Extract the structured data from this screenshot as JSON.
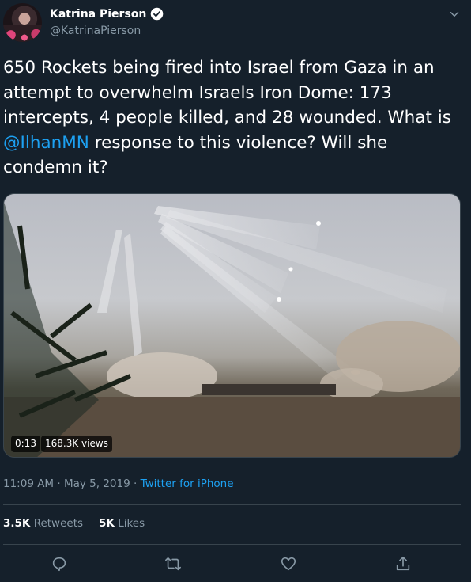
{
  "user": {
    "display_name": "Katrina Pierson",
    "handle": "@KatrinaPierson",
    "verified_icon": "verified-badge-icon"
  },
  "tweet": {
    "text_before": "650 Rockets being fired into Israel from Gaza in an attempt to overwhelm Israels Iron Dome: 173 intercepts, 4 people killed, and 28 wounded. What is ",
    "mention": "@IlhanMN",
    "text_after": " response to this violence? Will she condemn it?"
  },
  "media": {
    "duration": "0:13",
    "views": "168.3K views"
  },
  "meta": {
    "time": "11:09 AM · May 5, 2019 · ",
    "source": "Twitter for iPhone"
  },
  "stats": {
    "retweets_count": "3.5K",
    "retweets_label": "Retweets",
    "likes_count": "5K",
    "likes_label": "Likes"
  },
  "actions": {
    "reply_icon": "reply-icon",
    "retweet_icon": "retweet-icon",
    "like_icon": "heart-icon",
    "share_icon": "share-icon"
  },
  "colors": {
    "background": "#15202b",
    "accent": "#1da1f2",
    "secondary_text": "#8899a6",
    "border": "#38444d"
  }
}
